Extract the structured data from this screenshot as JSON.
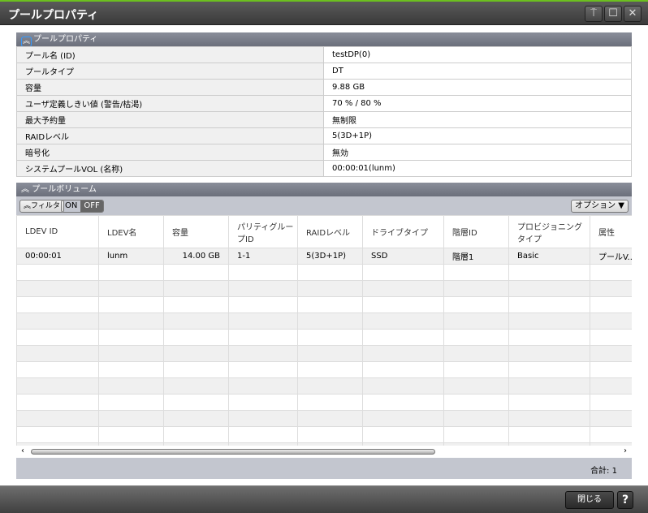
{
  "window": {
    "title": "プールプロパティ",
    "buttons": {
      "pin": "⍑",
      "maximize": "☐",
      "close": "✕"
    }
  },
  "properties": {
    "header": "プールプロパティ",
    "rows": [
      {
        "label": "プール名 (ID)",
        "value": "testDP(0)"
      },
      {
        "label": "プールタイプ",
        "value": "DT"
      },
      {
        "label": "容量",
        "value": "9.88 GB"
      },
      {
        "label": "ユーザ定義しきい値 (警告/枯渇)",
        "value": "70 % / 80 %"
      },
      {
        "label": "最大予約量",
        "value": "無制限"
      },
      {
        "label": "RAIDレベル",
        "value": "5(3D+1P)"
      },
      {
        "label": "暗号化",
        "value": "無効"
      },
      {
        "label": "システムプールVOL (名称)",
        "value": "00:00:01(lunm)"
      }
    ]
  },
  "volumes": {
    "header": "プールボリューム",
    "filter_label": "フィルタ",
    "on_label": "ON",
    "off_label": "OFF",
    "filter_state": "OFF",
    "options_label": "オプション",
    "columns": [
      "LDEV ID",
      "LDEV名",
      "容量",
      "パリティグループID",
      "RAIDレベル",
      "ドライブタイプ",
      "階層ID",
      "プロビジョニングタイプ",
      "属性"
    ],
    "rows": [
      [
        "00:00:01",
        "lunm",
        "14.00 GB",
        "1-1",
        "5(3D+1P)",
        "SSD",
        "階層1",
        "Basic",
        "プールV..."
      ]
    ],
    "total_label": "合計:",
    "total": "1"
  },
  "footer": {
    "close_label": "閉じる",
    "help_label": "?"
  }
}
